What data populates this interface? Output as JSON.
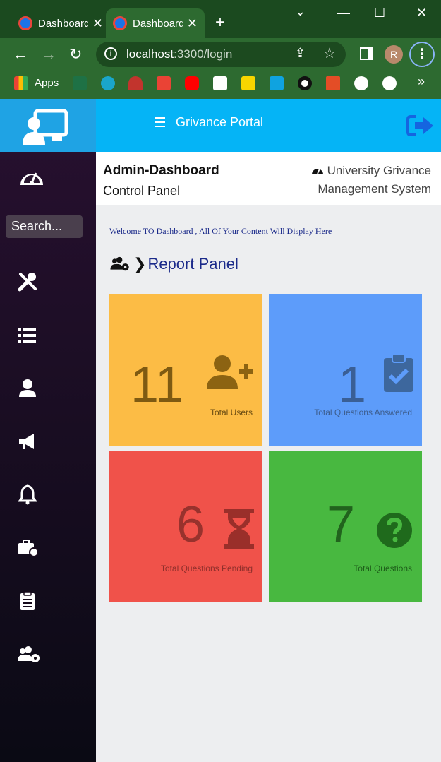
{
  "browser": {
    "tabs": [
      {
        "title": "Dashboard",
        "active": false
      },
      {
        "title": "Dashboard",
        "active": true
      }
    ],
    "new_tab_symbol": "+",
    "window_controls": {
      "minimize": "—",
      "maximize": "☐",
      "close": "✕"
    },
    "url_host": "localhost",
    "url_path": ":3300/login",
    "profile_initial": "R",
    "bookmarks_apps_label": "Apps",
    "bookmarks_more": "»"
  },
  "sidebar": {
    "search_placeholder": "Search...",
    "icons": [
      "monitor-user-icon",
      "dashboard-gauge-icon",
      "tools-icon",
      "list-icon",
      "user-icon",
      "megaphone-icon",
      "bell-icon",
      "briefcase-clock-icon",
      "clipboard-list-icon",
      "users-gear-icon"
    ]
  },
  "topbar": {
    "title": "Grivance Portal"
  },
  "header": {
    "title": "Admin-Dashboard",
    "subtitle": "Control Panel",
    "right_line1": "University Grivance",
    "right_line2": "Management System"
  },
  "main": {
    "welcome": "Welcome TO Dashboard , All Of Your Content Will Display Here",
    "section_title": "Report Panel",
    "cards": [
      {
        "value": "11",
        "label": "Total Users",
        "color": "#fcbc45",
        "icon": "user-plus-icon"
      },
      {
        "value": "1",
        "label": "Total Questions Answered",
        "color": "#5d9cfa",
        "icon": "clipboard-check-icon"
      },
      {
        "value": "6",
        "label": "Total Questions Pending",
        "color": "#f0524a",
        "icon": "hourglass-icon"
      },
      {
        "value": "7",
        "label": "Total Questions",
        "color": "#48b840",
        "icon": "question-circle-icon"
      }
    ]
  },
  "colors": {
    "sidebar_header": "#1fa3e4",
    "topbar": "#05b4f6",
    "heading_blue": "#1b2a8a"
  }
}
